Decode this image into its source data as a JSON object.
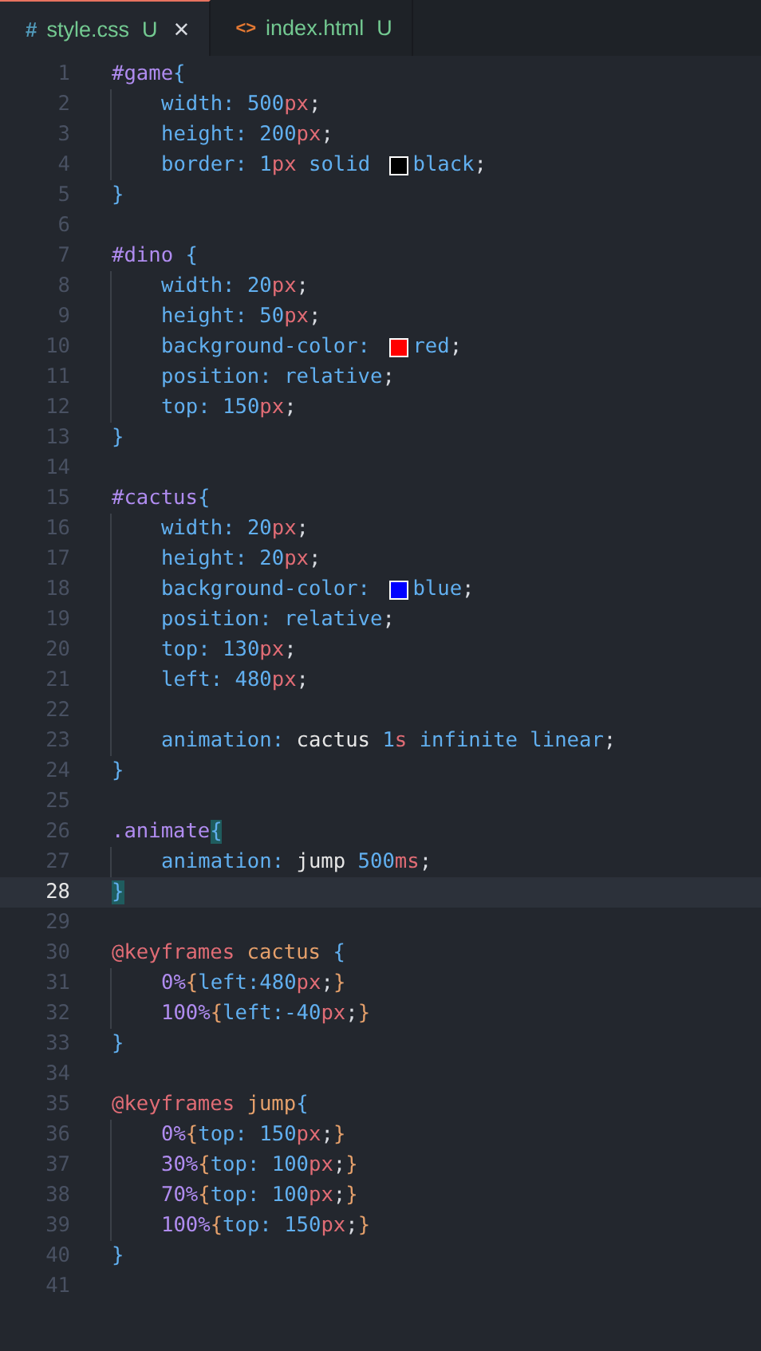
{
  "tabs": [
    {
      "icon": "#",
      "kind": "css",
      "label": "style.css",
      "status": "U",
      "selected": true,
      "close": "×"
    },
    {
      "icon": "<>",
      "kind": "html",
      "label": "index.html",
      "status": "U",
      "selected": false
    }
  ],
  "lines": [
    {
      "n": "1",
      "indented": false,
      "current": false,
      "tokens": [
        {
          "kind": "sel",
          "text": "#game"
        },
        {
          "kind": "brace",
          "text": "{"
        }
      ]
    },
    {
      "n": "2",
      "indented": true,
      "current": false,
      "tokens": [
        {
          "kind": "prop",
          "text": "width"
        },
        {
          "kind": "prop",
          "text": ": "
        },
        {
          "kind": "num",
          "text": "500"
        },
        {
          "kind": "unit",
          "text": "px"
        },
        {
          "kind": "semi",
          "text": ";"
        }
      ]
    },
    {
      "n": "3",
      "indented": true,
      "current": false,
      "tokens": [
        {
          "kind": "prop",
          "text": "height"
        },
        {
          "kind": "prop",
          "text": ": "
        },
        {
          "kind": "num",
          "text": "200"
        },
        {
          "kind": "unit",
          "text": "px"
        },
        {
          "kind": "semi",
          "text": ";"
        }
      ]
    },
    {
      "n": "4",
      "indented": true,
      "current": false,
      "tokens": [
        {
          "kind": "prop",
          "text": "border"
        },
        {
          "kind": "prop",
          "text": ": "
        },
        {
          "kind": "num",
          "text": "1"
        },
        {
          "kind": "unit",
          "text": "px"
        },
        {
          "kind": "value",
          "text": " solid "
        },
        {
          "kind": "swatch",
          "color": "#000000"
        },
        {
          "kind": "value",
          "text": "black"
        },
        {
          "kind": "semi",
          "text": ";"
        }
      ]
    },
    {
      "n": "5",
      "indented": false,
      "current": false,
      "tokens": [
        {
          "kind": "brace",
          "text": "}"
        }
      ]
    },
    {
      "n": "6",
      "indented": false,
      "current": false
    },
    {
      "n": "7",
      "indented": false,
      "current": false,
      "tokens": [
        {
          "kind": "sel",
          "text": "#dino"
        },
        {
          "kind": "brace",
          "text": " {"
        }
      ]
    },
    {
      "n": "8",
      "indented": true,
      "current": false,
      "tokens": [
        {
          "kind": "prop",
          "text": "width"
        },
        {
          "kind": "prop",
          "text": ": "
        },
        {
          "kind": "num",
          "text": "20"
        },
        {
          "kind": "unit",
          "text": "px"
        },
        {
          "kind": "semi",
          "text": ";"
        }
      ]
    },
    {
      "n": "9",
      "indented": true,
      "current": false,
      "tokens": [
        {
          "kind": "prop",
          "text": "height"
        },
        {
          "kind": "prop",
          "text": ": "
        },
        {
          "kind": "num",
          "text": "50"
        },
        {
          "kind": "unit",
          "text": "px"
        },
        {
          "kind": "semi",
          "text": ";"
        }
      ]
    },
    {
      "n": "10",
      "indented": true,
      "current": false,
      "tokens": [
        {
          "kind": "prop",
          "text": "background-color"
        },
        {
          "kind": "prop",
          "text": ": "
        },
        {
          "kind": "swatch",
          "color": "#ff0000"
        },
        {
          "kind": "value",
          "text": "red"
        },
        {
          "kind": "semi",
          "text": ";"
        }
      ]
    },
    {
      "n": "11",
      "indented": true,
      "current": false,
      "tokens": [
        {
          "kind": "prop",
          "text": "position"
        },
        {
          "kind": "prop",
          "text": ": "
        },
        {
          "kind": "value",
          "text": "relative"
        },
        {
          "kind": "semi",
          "text": ";"
        }
      ]
    },
    {
      "n": "12",
      "indented": true,
      "current": false,
      "tokens": [
        {
          "kind": "prop",
          "text": "top"
        },
        {
          "kind": "prop",
          "text": ": "
        },
        {
          "kind": "num",
          "text": "150"
        },
        {
          "kind": "unit",
          "text": "px"
        },
        {
          "kind": "semi",
          "text": ";"
        }
      ]
    },
    {
      "n": "13",
      "indented": false,
      "current": false,
      "tokens": [
        {
          "kind": "brace",
          "text": "}"
        }
      ]
    },
    {
      "n": "14",
      "indented": false,
      "current": false
    },
    {
      "n": "15",
      "indented": false,
      "current": false,
      "tokens": [
        {
          "kind": "sel",
          "text": "#cactus"
        },
        {
          "kind": "brace",
          "text": "{"
        }
      ]
    },
    {
      "n": "16",
      "indented": true,
      "current": false,
      "tokens": [
        {
          "kind": "prop",
          "text": "width"
        },
        {
          "kind": "prop",
          "text": ": "
        },
        {
          "kind": "num",
          "text": "20"
        },
        {
          "kind": "unit",
          "text": "px"
        },
        {
          "kind": "semi",
          "text": ";"
        }
      ]
    },
    {
      "n": "17",
      "indented": true,
      "current": false,
      "tokens": [
        {
          "kind": "prop",
          "text": "height"
        },
        {
          "kind": "prop",
          "text": ": "
        },
        {
          "kind": "num",
          "text": "20"
        },
        {
          "kind": "unit",
          "text": "px"
        },
        {
          "kind": "semi",
          "text": ";"
        }
      ]
    },
    {
      "n": "18",
      "indented": true,
      "current": false,
      "tokens": [
        {
          "kind": "prop",
          "text": "background-color"
        },
        {
          "kind": "prop",
          "text": ": "
        },
        {
          "kind": "swatch",
          "color": "#0000ff"
        },
        {
          "kind": "value",
          "text": "blue"
        },
        {
          "kind": "semi",
          "text": ";"
        }
      ]
    },
    {
      "n": "19",
      "indented": true,
      "current": false,
      "tokens": [
        {
          "kind": "prop",
          "text": "position"
        },
        {
          "kind": "prop",
          "text": ": "
        },
        {
          "kind": "value",
          "text": "relative"
        },
        {
          "kind": "semi",
          "text": ";"
        }
      ]
    },
    {
      "n": "20",
      "indented": true,
      "current": false,
      "tokens": [
        {
          "kind": "prop",
          "text": "top"
        },
        {
          "kind": "prop",
          "text": ": "
        },
        {
          "kind": "num",
          "text": "130"
        },
        {
          "kind": "unit",
          "text": "px"
        },
        {
          "kind": "semi",
          "text": ";"
        }
      ]
    },
    {
      "n": "21",
      "indented": true,
      "current": false,
      "tokens": [
        {
          "kind": "prop",
          "text": "left"
        },
        {
          "kind": "prop",
          "text": ": "
        },
        {
          "kind": "num",
          "text": "480"
        },
        {
          "kind": "unit",
          "text": "px"
        },
        {
          "kind": "semi",
          "text": ";"
        }
      ]
    },
    {
      "n": "22",
      "indented": true,
      "current": false
    },
    {
      "n": "23",
      "indented": true,
      "current": false,
      "tokens": [
        {
          "kind": "prop",
          "text": "animation"
        },
        {
          "kind": "prop",
          "text": ": "
        },
        {
          "kind": "ident",
          "text": "cactus "
        },
        {
          "kind": "num",
          "text": "1"
        },
        {
          "kind": "unit",
          "text": "s"
        },
        {
          "kind": "value",
          "text": " infinite linear"
        },
        {
          "kind": "semi",
          "text": ";"
        }
      ]
    },
    {
      "n": "24",
      "indented": false,
      "current": false,
      "tokens": [
        {
          "kind": "brace",
          "text": "}"
        }
      ]
    },
    {
      "n": "25",
      "indented": false,
      "current": false
    },
    {
      "n": "26",
      "indented": false,
      "current": false,
      "tokens": [
        {
          "kind": "sel",
          "text": ".animate"
        },
        {
          "kind": "match",
          "text": "{"
        }
      ]
    },
    {
      "n": "27",
      "indented": true,
      "current": false,
      "tokens": [
        {
          "kind": "prop",
          "text": "animation"
        },
        {
          "kind": "prop",
          "text": ": "
        },
        {
          "kind": "ident",
          "text": "jump "
        },
        {
          "kind": "num",
          "text": "500"
        },
        {
          "kind": "unit",
          "text": "ms"
        },
        {
          "kind": "semi",
          "text": ";"
        }
      ]
    },
    {
      "n": "28",
      "indented": false,
      "current": true,
      "tokens": [
        {
          "kind": "match",
          "text": "}"
        }
      ]
    },
    {
      "n": "29",
      "indented": false,
      "current": false
    },
    {
      "n": "30",
      "indented": false,
      "current": false,
      "tokens": [
        {
          "kind": "at",
          "text": "@keyframes"
        },
        {
          "kind": "name",
          "text": " cactus "
        },
        {
          "kind": "brace",
          "text": "{"
        }
      ]
    },
    {
      "n": "31",
      "indented": true,
      "current": false,
      "tokens": [
        {
          "kind": "sel",
          "text": "0%"
        },
        {
          "kind": "kbrace",
          "text": "{"
        },
        {
          "kind": "prop",
          "text": "left:"
        },
        {
          "kind": "num",
          "text": "480"
        },
        {
          "kind": "unit",
          "text": "px"
        },
        {
          "kind": "semi",
          "text": ";"
        },
        {
          "kind": "kbrace",
          "text": "}"
        }
      ]
    },
    {
      "n": "32",
      "indented": true,
      "current": false,
      "tokens": [
        {
          "kind": "sel",
          "text": "100%"
        },
        {
          "kind": "kbrace",
          "text": "{"
        },
        {
          "kind": "prop",
          "text": "left:"
        },
        {
          "kind": "num",
          "text": "-40"
        },
        {
          "kind": "unit",
          "text": "px"
        },
        {
          "kind": "semi",
          "text": ";"
        },
        {
          "kind": "kbrace",
          "text": "}"
        }
      ]
    },
    {
      "n": "33",
      "indented": false,
      "current": false,
      "tokens": [
        {
          "kind": "brace",
          "text": "}"
        }
      ]
    },
    {
      "n": "34",
      "indented": false,
      "current": false
    },
    {
      "n": "35",
      "indented": false,
      "current": false,
      "tokens": [
        {
          "kind": "at",
          "text": "@keyframes"
        },
        {
          "kind": "name",
          "text": " jump"
        },
        {
          "kind": "brace",
          "text": "{"
        }
      ]
    },
    {
      "n": "36",
      "indented": true,
      "current": false,
      "tokens": [
        {
          "kind": "sel",
          "text": "0%"
        },
        {
          "kind": "kbrace",
          "text": "{"
        },
        {
          "kind": "prop",
          "text": "top: "
        },
        {
          "kind": "num",
          "text": "150"
        },
        {
          "kind": "unit",
          "text": "px"
        },
        {
          "kind": "semi",
          "text": ";"
        },
        {
          "kind": "kbrace",
          "text": "}"
        }
      ]
    },
    {
      "n": "37",
      "indented": true,
      "current": false,
      "tokens": [
        {
          "kind": "sel",
          "text": "30%"
        },
        {
          "kind": "kbrace",
          "text": "{"
        },
        {
          "kind": "prop",
          "text": "top: "
        },
        {
          "kind": "num",
          "text": "100"
        },
        {
          "kind": "unit",
          "text": "px"
        },
        {
          "kind": "semi",
          "text": ";"
        },
        {
          "kind": "kbrace",
          "text": "}"
        }
      ]
    },
    {
      "n": "38",
      "indented": true,
      "current": false,
      "tokens": [
        {
          "kind": "sel",
          "text": "70%"
        },
        {
          "kind": "kbrace",
          "text": "{"
        },
        {
          "kind": "prop",
          "text": "top: "
        },
        {
          "kind": "num",
          "text": "100"
        },
        {
          "kind": "unit",
          "text": "px"
        },
        {
          "kind": "semi",
          "text": ";"
        },
        {
          "kind": "kbrace",
          "text": "}"
        }
      ]
    },
    {
      "n": "39",
      "indented": true,
      "current": false,
      "tokens": [
        {
          "kind": "sel",
          "text": "100%"
        },
        {
          "kind": "kbrace",
          "text": "{"
        },
        {
          "kind": "prop",
          "text": "top: "
        },
        {
          "kind": "num",
          "text": "150"
        },
        {
          "kind": "unit",
          "text": "px"
        },
        {
          "kind": "semi",
          "text": ";"
        },
        {
          "kind": "kbrace",
          "text": "}"
        }
      ]
    },
    {
      "n": "40",
      "indented": false,
      "current": false,
      "tokens": [
        {
          "kind": "brace",
          "text": "}"
        }
      ]
    },
    {
      "n": "41",
      "indented": false,
      "current": false
    }
  ]
}
